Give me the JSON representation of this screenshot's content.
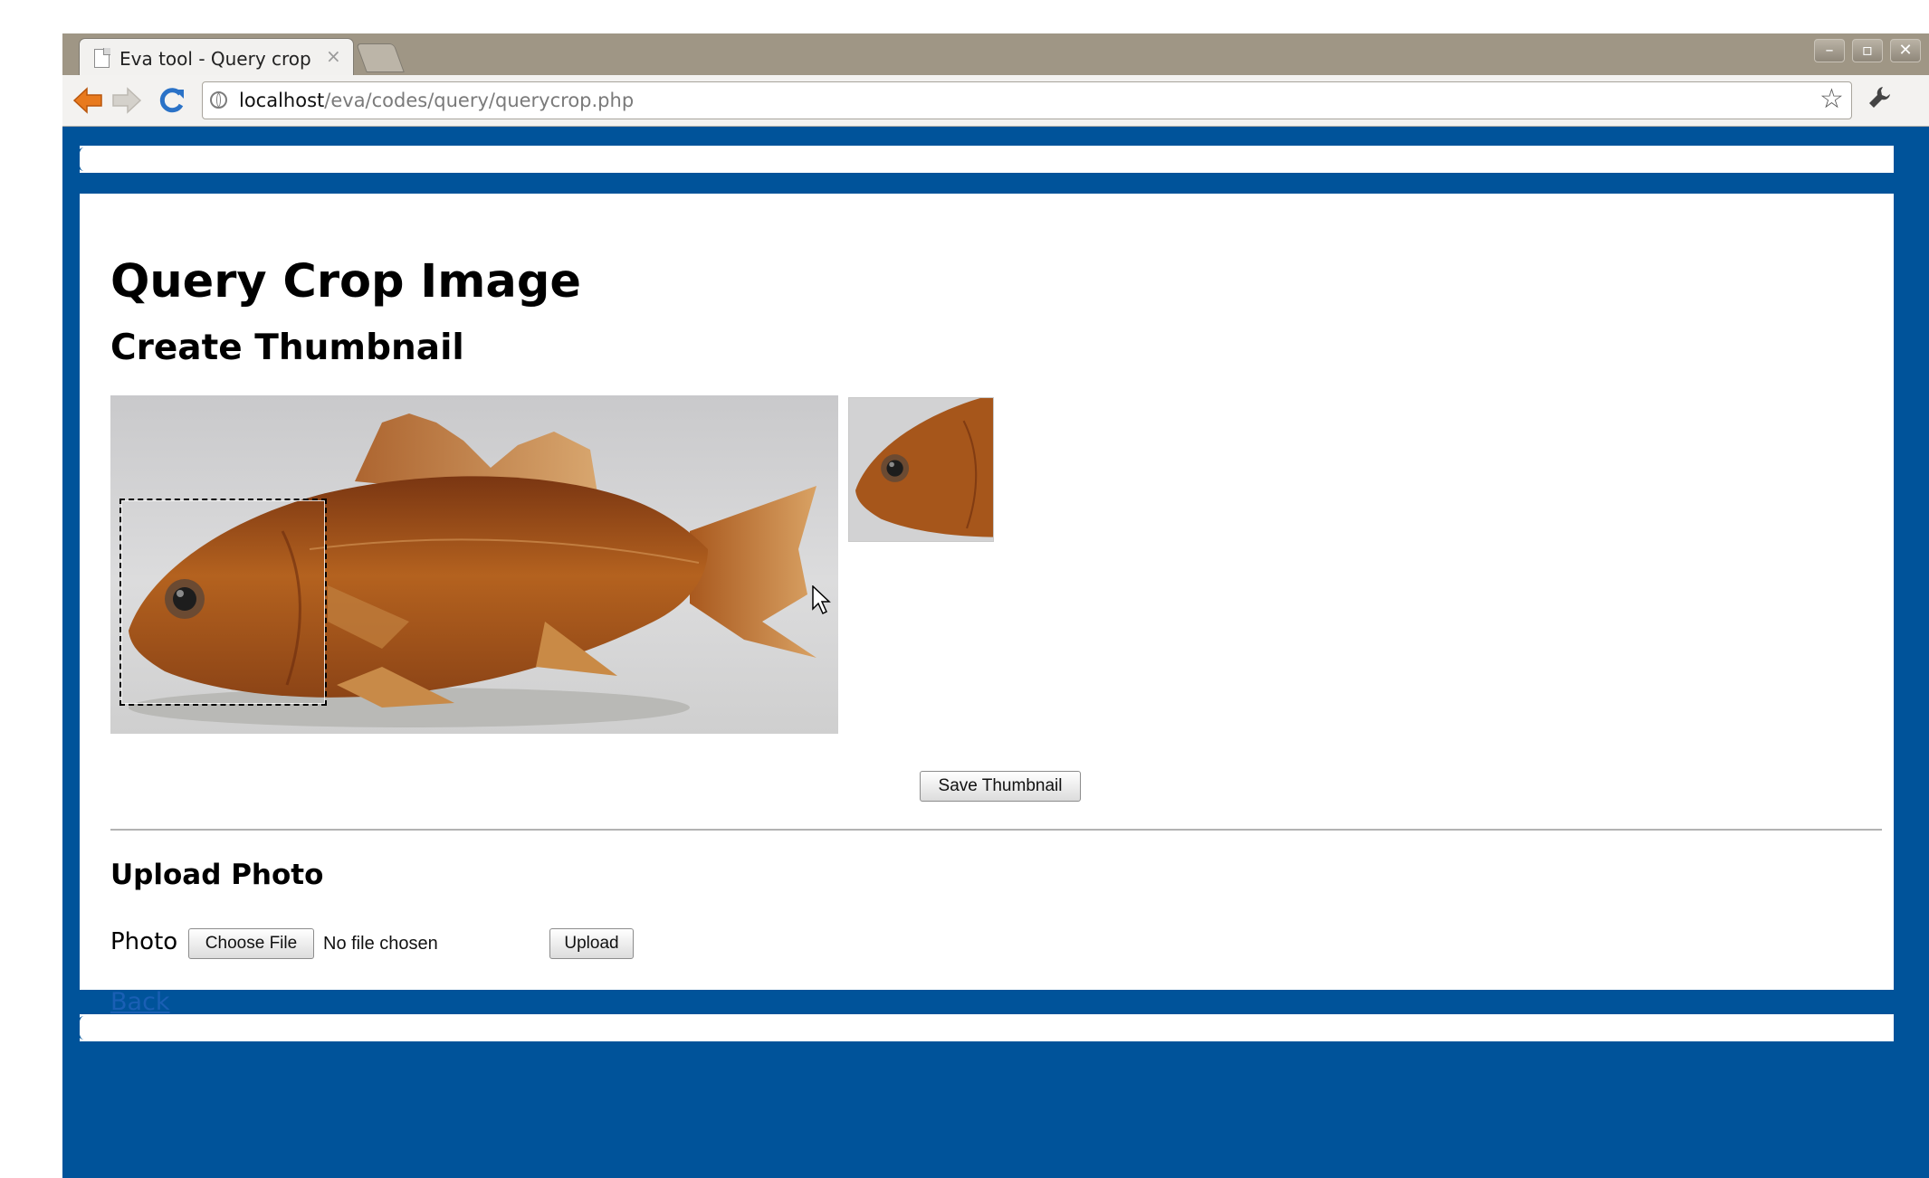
{
  "browser": {
    "tab_title": "Eva tool - Query crop",
    "tab_close_glyph": "×",
    "url_host": "localhost",
    "url_path": "/eva/codes/query/querycrop.php",
    "icons": {
      "back": "back-arrow-icon",
      "forward": "forward-arrow-icon",
      "reload": "reload-icon",
      "site": "globe-icon",
      "bookmark": "star-icon",
      "menu": "wrench-icon"
    },
    "window_controls": [
      "–",
      "▫",
      "✕"
    ]
  },
  "page": {
    "title": "Query Crop Image",
    "section_title": "Create Thumbnail",
    "save_thumbnail_label": "Save Thumbnail",
    "upload_title": "Upload Photo",
    "photo_label": "Photo",
    "choose_file_label": "Choose File",
    "file_status": "No file chosen",
    "upload_label": "Upload",
    "back_label": "Back"
  },
  "colors": {
    "page_background": "#00539a",
    "tabstrip": "#9f9685",
    "link": "#1a5fb4"
  }
}
